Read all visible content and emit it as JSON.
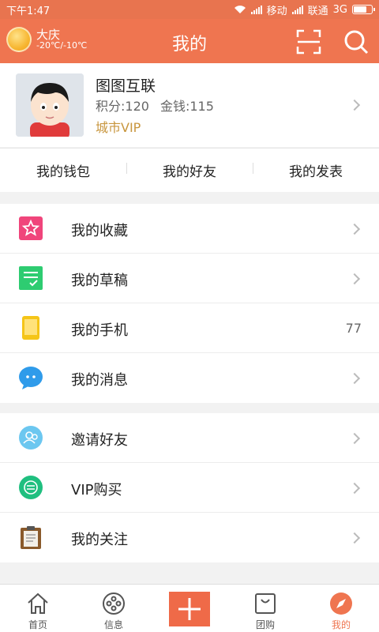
{
  "status": {
    "time": "下午1:47",
    "carrier1": "移动",
    "carrier2": "联通",
    "network": "3G"
  },
  "header": {
    "title": "我的",
    "weather_city": "大庆",
    "weather_temp": "-20℃/-10℃"
  },
  "profile": {
    "name": "图图互联",
    "points_label": "积分:120",
    "money_label": "金钱:115",
    "vip": "城市VIP"
  },
  "quick": [
    "我的钱包",
    "我的好友",
    "我的发表"
  ],
  "group1": [
    {
      "label": "我的收藏",
      "icon": "star-icon"
    },
    {
      "label": "我的草稿",
      "icon": "draft-icon"
    },
    {
      "label": "我的手机",
      "icon": "phone-icon",
      "count": "77"
    },
    {
      "label": "我的消息",
      "icon": "message-icon"
    }
  ],
  "group2": [
    {
      "label": "邀请好友",
      "icon": "invite-icon"
    },
    {
      "label": "VIP购买",
      "icon": "vip-icon"
    },
    {
      "label": "我的关注",
      "icon": "clipboard-icon"
    }
  ],
  "tabs": [
    {
      "label": "首页",
      "icon": "home-icon"
    },
    {
      "label": "信息",
      "icon": "info-icon"
    },
    {
      "label": "",
      "icon": "plus-icon"
    },
    {
      "label": "团购",
      "icon": "groupbuy-icon"
    },
    {
      "label": "我的",
      "icon": "compass-icon",
      "active": true
    }
  ],
  "colors": {
    "accent": "#ef7550",
    "vip": "#c8963e"
  }
}
